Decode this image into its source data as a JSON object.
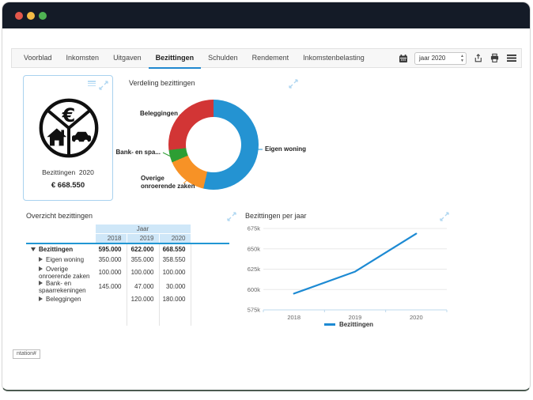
{
  "window": {
    "traffic_lights": [
      "close",
      "minimize",
      "zoom"
    ]
  },
  "navbar": {
    "tabs": [
      {
        "label": "Voorblad",
        "active": false
      },
      {
        "label": "Inkomsten",
        "active": false
      },
      {
        "label": "Uitgaven",
        "active": false
      },
      {
        "label": "Bezittingen",
        "active": true
      },
      {
        "label": "Schulden",
        "active": false
      },
      {
        "label": "Rendement",
        "active": false
      },
      {
        "label": "Inkomstenbelasting",
        "active": false
      }
    ],
    "year_select": {
      "value": "jaar 2020"
    },
    "icons": [
      "calendar-icon",
      "export-icon",
      "print-icon",
      "menu-icon"
    ]
  },
  "summary_card": {
    "title": "Bezittingen  2020",
    "value": "€ 668.550",
    "icon": "assets-circle-icon (euro, house, car)"
  },
  "donut_panel": {
    "title": "Verdeling bezittingen",
    "labels": {
      "beleggingen": "Beleggingen",
      "eigen_woning": "Eigen woning",
      "bank": "Bank- en spa...",
      "overige": "Overige\nonroerende zaken"
    }
  },
  "table_panel": {
    "title": "Overzicht bezittingen",
    "col_group": "Jaar",
    "columns": [
      "2018",
      "2019",
      "2020"
    ],
    "rows": [
      {
        "label": "Bezittingen",
        "values": [
          "595.000",
          "622.000",
          "668.550"
        ],
        "bold": true,
        "expanded": true
      },
      {
        "label": "Eigen woning",
        "values": [
          "350.000",
          "355.000",
          "358.550"
        ]
      },
      {
        "label": "Overige onroerende zaken",
        "values": [
          "100.000",
          "100.000",
          "100.000"
        ]
      },
      {
        "label": "Bank- en spaarrekeningen",
        "values": [
          "145.000",
          "47.000",
          "30.000"
        ]
      },
      {
        "label": "Beleggingen",
        "values": [
          "",
          "120.000",
          "180.000"
        ]
      }
    ]
  },
  "line_panel": {
    "title": "Bezittingen per jaar"
  },
  "chart_data": [
    {
      "type": "pie",
      "subtype": "donut",
      "title": "Verdeling bezittingen",
      "slices": [
        {
          "label": "Eigen woning",
          "value": 358550,
          "color": "#2493d2"
        },
        {
          "label": "Overige onroerende zaken",
          "value": 100000,
          "color": "#f79226"
        },
        {
          "label": "Bank- en spaarrekeningen",
          "value": 30000,
          "color": "#2d9e33"
        },
        {
          "label": "Beleggingen",
          "value": 180000,
          "color": "#d23535"
        }
      ],
      "start_angle_deg": 0,
      "direction": "clockwise",
      "legend_position": "outside-labels"
    },
    {
      "type": "line",
      "title": "Bezittingen per jaar",
      "categories": [
        "2018",
        "2019",
        "2020"
      ],
      "series": [
        {
          "name": "Bezittingen",
          "values": [
            595000,
            622000,
            668550
          ],
          "color": "#1d8ad3"
        }
      ],
      "ylim": [
        575000,
        675000
      ],
      "yticks": [
        "575k",
        "600k",
        "625k",
        "650k",
        "675k"
      ],
      "grid": true,
      "legend_position": "bottom"
    }
  ],
  "status_tooltip": "ntation#",
  "colors": {
    "titlebar": "#141b27",
    "accent_blue": "#2196d3",
    "table_header_bg": "#cfe7f8",
    "light_blue_icon": "#aed6f1",
    "card_border": "#a9d2ef",
    "navbar_bg": "#f7f7f7"
  }
}
